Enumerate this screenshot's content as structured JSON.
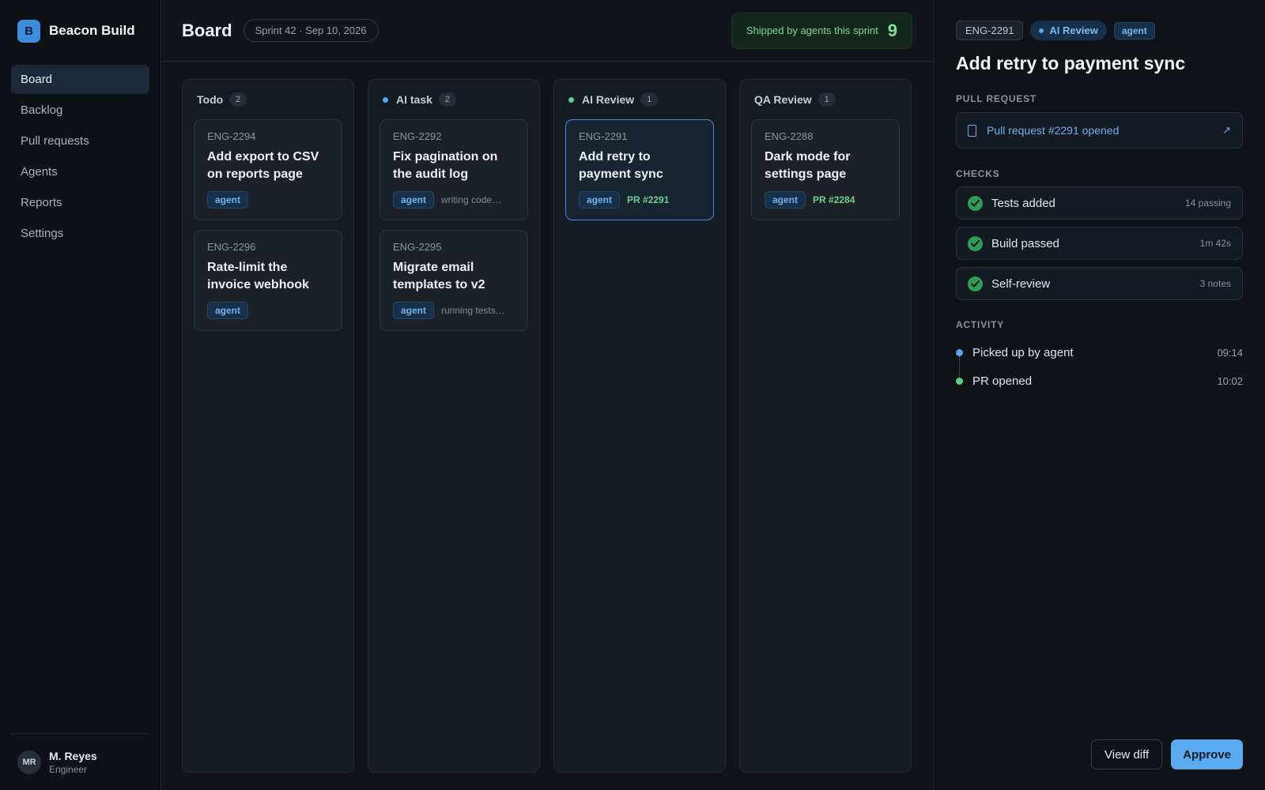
{
  "brand": {
    "logo_letter": "B",
    "name": "Beacon Build"
  },
  "nav": {
    "items": [
      {
        "label": "Board",
        "active": true
      },
      {
        "label": "Backlog"
      },
      {
        "label": "Pull requests"
      },
      {
        "label": "Agents"
      },
      {
        "label": "Reports"
      },
      {
        "label": "Settings"
      }
    ]
  },
  "user": {
    "initials": "MR",
    "name": "M. Reyes",
    "role": "Engineer"
  },
  "header": {
    "title": "Board",
    "sprint": "Sprint 42 · Sep 10, 2026",
    "shipped_label": "Shipped by agents this sprint",
    "shipped_count": "9"
  },
  "columns": [
    {
      "title": "Todo",
      "count": "2",
      "cards": [
        {
          "id": "ENG-2294",
          "title": "Add export to CSV on reports page",
          "tag": "agent"
        },
        {
          "id": "ENG-2296",
          "title": "Rate-limit the invoice webhook",
          "tag": "agent"
        }
      ]
    },
    {
      "title": "AI task",
      "count": "2",
      "dot_color": "#58a6f0",
      "cards": [
        {
          "id": "ENG-2292",
          "title": "Fix pagination on the audit log",
          "tag": "agent",
          "status": "writing code…"
        },
        {
          "id": "ENG-2295",
          "title": "Migrate email templates to v2",
          "tag": "agent",
          "status": "running tests…"
        }
      ]
    },
    {
      "title": "AI Review",
      "count": "1",
      "dot_color": "#5fcf7f",
      "cards": [
        {
          "id": "ENG-2291",
          "title": "Add retry to payment sync",
          "tag": "agent",
          "pr": "PR #2291",
          "selected": true
        }
      ]
    },
    {
      "title": "QA Review",
      "count": "1",
      "cards": [
        {
          "id": "ENG-2288",
          "title": "Dark mode for settings page",
          "tag": "agent",
          "pr": "PR #2284"
        }
      ]
    }
  ],
  "detail": {
    "id": "ENG-2291",
    "status": "AI Review",
    "tag": "agent",
    "title": "Add retry to payment sync",
    "pull_request_label": "PULL REQUEST",
    "pull_request_text": "Pull request #2291 opened",
    "external_icon": "↗",
    "checks_label": "CHECKS",
    "checks": [
      {
        "label": "Tests added",
        "meta": "14 passing"
      },
      {
        "label": "Build passed",
        "meta": "1m 42s"
      },
      {
        "label": "Self-review",
        "meta": "3 notes"
      }
    ],
    "activity_label": "ACTIVITY",
    "activity": [
      {
        "text": "Picked up by agent",
        "time": "09:14",
        "dot": "blue"
      },
      {
        "text": "PR opened",
        "time": "10:02",
        "dot": "green"
      }
    ],
    "view_diff_label": "View diff",
    "approve_label": "Approve"
  },
  "colors": {
    "accent": "#58a6f0",
    "success": "#5fcf7f",
    "background": "#11151b"
  }
}
